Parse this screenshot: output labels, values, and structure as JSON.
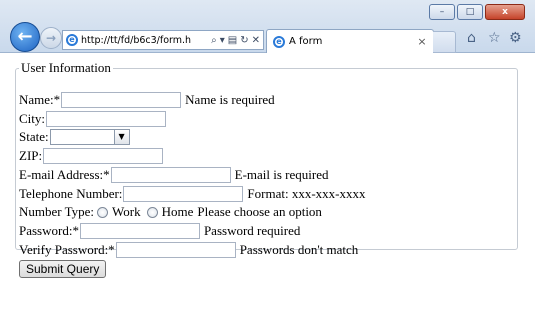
{
  "browser": {
    "address": "http://tt/fd/b6c3/form.h",
    "tab_title": "A form",
    "window_buttons": {
      "minimize": "–",
      "maximize": "□",
      "close": "x"
    },
    "address_tools": {
      "search": "⌕",
      "dropdown": "▾",
      "compat": "▤",
      "refresh": "↻",
      "stop": "✕"
    },
    "tab_close": "×",
    "toolbar_icons": {
      "home": "⌂",
      "favorites": "☆",
      "tools": "⚙"
    },
    "back_glyph": "←",
    "forward_glyph": "→",
    "ie_glyph": "e"
  },
  "form": {
    "legend": "User Information",
    "name": {
      "label": "Name:*",
      "message": "Name is required"
    },
    "city": {
      "label": "City:"
    },
    "state": {
      "label": "State:",
      "arrow": "▼"
    },
    "zip": {
      "label": "ZIP:"
    },
    "email": {
      "label": "E-mail Address:*",
      "message": "E-mail is required"
    },
    "telephone": {
      "label": "Telephone Number:",
      "message": "Format: xxx-xxx-xxxx"
    },
    "number_type": {
      "label": "Number Type:",
      "option_work": "Work",
      "option_home": "Home",
      "message": "Please choose an option"
    },
    "password": {
      "label": "Password:*",
      "message": "Password required"
    },
    "verify_password": {
      "label": "Verify Password:*",
      "message": "Passwords don't match"
    },
    "submit_label": "Submit Query"
  }
}
